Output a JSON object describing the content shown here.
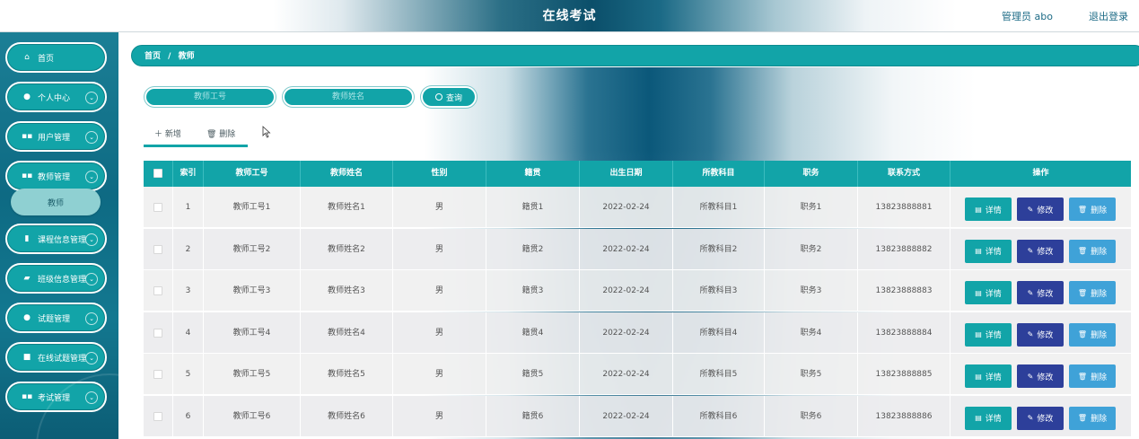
{
  "header": {
    "title": "在线考试",
    "user_label": "管理员 abo",
    "logout_label": "退出登录"
  },
  "sidebar": {
    "items": [
      {
        "label": "首页",
        "icon": "home-icon"
      },
      {
        "label": "个人中心",
        "icon": "user-icon"
      },
      {
        "label": "用户管理",
        "icon": "grid-icon"
      },
      {
        "label": "教师管理",
        "icon": "grid-icon"
      },
      {
        "label": "课程信息管理",
        "icon": "clipboard-icon"
      },
      {
        "label": "班级信息管理",
        "icon": "thumb-icon"
      },
      {
        "label": "试题管理",
        "icon": "pin-icon"
      },
      {
        "label": "在线试题管理",
        "icon": "doc-icon"
      },
      {
        "label": "考试管理",
        "icon": "grid-icon"
      }
    ],
    "active_sub": "教师"
  },
  "breadcrumb": {
    "home": "首页",
    "separator": "/",
    "current": "教师"
  },
  "search": {
    "teacher_id_placeholder": "教师工号",
    "teacher_name_placeholder": "教师姓名",
    "query_label": "查询"
  },
  "actions": {
    "add_label": "新增",
    "delete_label": "删除"
  },
  "table": {
    "columns": [
      "索引",
      "教师工号",
      "教师姓名",
      "性别",
      "籍贯",
      "出生日期",
      "所教科目",
      "职务",
      "联系方式",
      "操作"
    ],
    "rows": [
      {
        "index": "1",
        "teacher_id": "教师工号1",
        "name": "教师姓名1",
        "gender": "男",
        "hometown": "籍贯1",
        "birth": "2022-02-24",
        "subject": "所教科目1",
        "position": "职务1",
        "phone": "13823888881"
      },
      {
        "index": "2",
        "teacher_id": "教师工号2",
        "name": "教师姓名2",
        "gender": "男",
        "hometown": "籍贯2",
        "birth": "2022-02-24",
        "subject": "所教科目2",
        "position": "职务2",
        "phone": "13823888882"
      },
      {
        "index": "3",
        "teacher_id": "教师工号3",
        "name": "教师姓名3",
        "gender": "男",
        "hometown": "籍贯3",
        "birth": "2022-02-24",
        "subject": "所教科目3",
        "position": "职务3",
        "phone": "13823888883"
      },
      {
        "index": "4",
        "teacher_id": "教师工号4",
        "name": "教师姓名4",
        "gender": "男",
        "hometown": "籍贯4",
        "birth": "2022-02-24",
        "subject": "所教科目4",
        "position": "职务4",
        "phone": "13823888884"
      },
      {
        "index": "5",
        "teacher_id": "教师工号5",
        "name": "教师姓名5",
        "gender": "男",
        "hometown": "籍贯5",
        "birth": "2022-02-24",
        "subject": "所教科目5",
        "position": "职务5",
        "phone": "13823888885"
      },
      {
        "index": "6",
        "teacher_id": "教师工号6",
        "name": "教师姓名6",
        "gender": "男",
        "hometown": "籍贯6",
        "birth": "2022-02-24",
        "subject": "所教科目6",
        "position": "职务6",
        "phone": "13823888886"
      }
    ],
    "op_labels": {
      "detail": "详情",
      "edit": "修改",
      "delete": "删除"
    }
  },
  "colors": {
    "accent": "#12a4a8",
    "edit_button": "#2d3f9a",
    "delete_button": "#3fa2d8",
    "sidebar_dark": "#0e6a83"
  }
}
